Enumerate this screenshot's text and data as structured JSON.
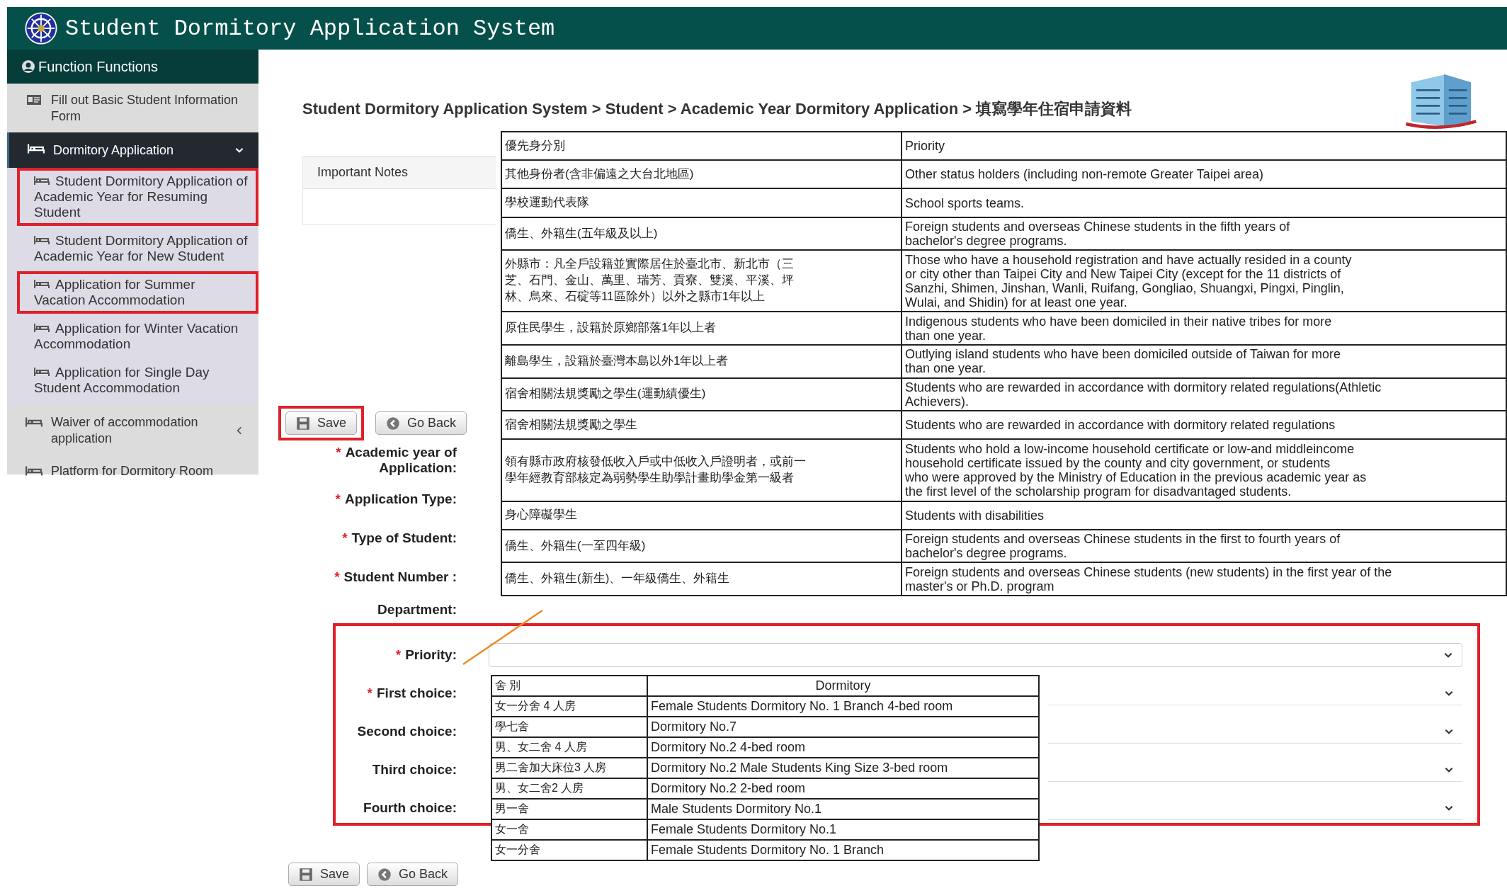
{
  "header": {
    "title": "Student Dormitory Application System"
  },
  "sidebar": {
    "heading": "Function Functions",
    "items": [
      {
        "label": "Fill out Basic Student Information Form",
        "kind": "form"
      },
      {
        "label": "Dormitory Application",
        "kind": "group",
        "expanded": true,
        "children": [
          {
            "label": "Student Dormitory Application of Academic Year for Resuming Student",
            "annotated": true
          },
          {
            "label": "Student Dormitory Application of Academic Year for New Student",
            "annotated": false
          },
          {
            "label": "Application for Summer Vacation Accommodation",
            "annotated": true
          },
          {
            "label": "Application for Winter Vacation Accommodation",
            "annotated": false
          },
          {
            "label": "Application for Single Day Student Accommodation",
            "annotated": false
          }
        ]
      },
      {
        "label": "Waiver of accommodation application",
        "kind": "group",
        "expanded": false
      },
      {
        "label": "Platform for Dormitory Room",
        "kind": "page"
      }
    ]
  },
  "breadcrumb": "Student Dormitory Application System > Student > Academic Year Dormitory Application > 填寫學年住宿申請資料",
  "notes": {
    "title": "Important Notes"
  },
  "top_buttons": [
    {
      "label": "Save",
      "kind": "save",
      "annotated": true
    },
    {
      "label": "Go Back",
      "kind": "back",
      "annotated": false
    }
  ],
  "form_fields": [
    {
      "mark": "*",
      "label": "Academic year of Application:"
    },
    {
      "mark": "*",
      "label": "Application Type:"
    },
    {
      "mark": "*",
      "label": "Type of Student:"
    },
    {
      "mark": "*",
      "label": "Student Number :"
    },
    {
      "label": "Department:"
    }
  ],
  "priority_table": {
    "rows": [
      {
        "zh": [
          "優先身分別"
        ],
        "en": [
          "Priority"
        ]
      },
      {
        "zh": [
          "其他身份者(含非偏遠之大台北地區)"
        ],
        "en": [
          "Other status holders (including non-remote Greater Taipei area)"
        ]
      },
      {
        "zh": [
          "學校運動代表隊"
        ],
        "en": [
          "School sports teams."
        ]
      },
      {
        "zh": [
          "僑生、外籍生(五年級及以上)"
        ],
        "en": [
          "Foreign students and overseas Chinese students in the fifth years of",
          "bachelor's degree programs."
        ]
      },
      {
        "zh": [
          "外縣市：凡全戶設籍並實際居住於臺北市、新北市（三",
          "芝、石門、金山、萬里、瑞芳、貢寮、雙溪、平溪、坪",
          "林、烏來、石碇等11區除外）以外之縣市1年以上"
        ],
        "en": [
          "Those who have a household registration and have actually resided in a county",
          "or city other than Taipei City and New Taipei City (except for the 11 districts of",
          "Sanzhi, Shimen, Jinshan, Wanli, Ruifang, Gongliao, Shuangxi, Pingxi, Pinglin,",
          "Wulai, and Shidin) for at least one year."
        ]
      },
      {
        "zh": [
          "原住民學生，設籍於原鄉部落1年以上者"
        ],
        "en": [
          "Indigenous students who have been domiciled in their native tribes for more",
          "than one year."
        ]
      },
      {
        "zh": [
          "離島學生，設籍於臺灣本島以外1年以上者"
        ],
        "en": [
          "Outlying island students who have been domiciled outside of Taiwan for more",
          "than one year."
        ]
      },
      {
        "zh": [
          "宿舍相關法規獎勵之學生(運動績優生)"
        ],
        "en": [
          "Students who are rewarded in accordance with dormitory related regulations(Athletic",
          "Achievers)."
        ]
      },
      {
        "zh": [
          "宿舍相關法規獎勵之學生"
        ],
        "en": [
          "Students who are rewarded in accordance with dormitory related regulations"
        ]
      },
      {
        "zh": [
          "領有縣市政府核發低收入戶或中低收入戶證明者，或前一",
          "學年經教育部核定為弱勢學生助學計畫助學金第一級者"
        ],
        "en": [
          "Students who hold a low-income household certificate or low-and middleincome",
          "household certificate issued by the county and city government, or students",
          "who were approved by the Ministry of Education in the previous academic year as",
          "the first level of the scholarship program for disadvantaged students."
        ]
      },
      {
        "zh": [
          "身心障礙學生"
        ],
        "en": [
          "Students with disabilities"
        ]
      },
      {
        "zh": [
          "僑生、外籍生(一至四年級)"
        ],
        "en": [
          "Foreign students and overseas Chinese students in the first to fourth years of",
          "bachelor's degree programs."
        ]
      },
      {
        "zh": [
          "僑生、外籍生(新生)、一年級僑生、外籍生"
        ],
        "en": [
          "Foreign students and overseas Chinese students (new students) in the first year of the",
          "master's or Ph.D. program"
        ]
      }
    ]
  },
  "choice_form": {
    "annotated": true,
    "fields": [
      {
        "mark": "*",
        "label": "Priority:"
      },
      {
        "mark": "*",
        "label": "First choice:"
      },
      {
        "label": "Second choice:"
      },
      {
        "label": "Third choice:"
      },
      {
        "label": "Fourth choice:"
      }
    ]
  },
  "dorm_table": {
    "columns": [
      "舍 別",
      "Dormitory"
    ],
    "rows": [
      [
        "女一分舍 4 人房",
        "Female Students Dormitory No. 1 Branch 4-bed room"
      ],
      [
        "學七舍",
        "Dormitory No.7"
      ],
      [
        "男、女二舍 4 人房",
        "Dormitory No.2 4-bed room"
      ],
      [
        "男二舍加大床位3 人房",
        "Dormitory No.2 Male Students King Size 3-bed room"
      ],
      [
        "男、女二舍2 人房",
        "Dormitory No.2 2-bed room"
      ],
      [
        "男一舍",
        "Male Students Dormitory No.1"
      ],
      [
        "女一舍",
        "Female Students Dormitory No.1"
      ],
      [
        "女一分舍",
        "Female Students Dormitory No. 1 Branch"
      ]
    ]
  },
  "bottom_buttons": [
    {
      "label": "Save",
      "kind": "save"
    },
    {
      "label": "Go Back",
      "kind": "back"
    }
  ]
}
